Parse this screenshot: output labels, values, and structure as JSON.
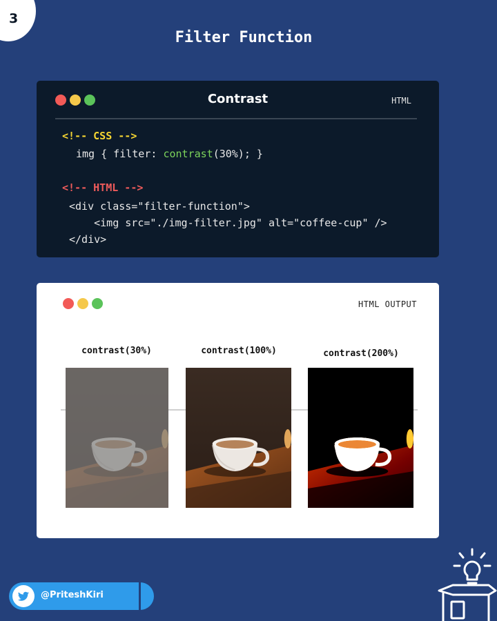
{
  "page_number": "3",
  "slide_title": "Filter Function",
  "code_card": {
    "title": "Contrast",
    "lang": "HTML",
    "css_comment": "<!-- CSS -->",
    "css_line": {
      "selector": "img { filter: ",
      "func": "contrast",
      "args": "(30%); }"
    },
    "html_comment": "<!-- HTML -->",
    "html_lines": [
      "<div class=\"filter-function\">",
      "    <img src=\"./img-filter.jpg\" alt=\"coffee-cup\" />",
      "</div>"
    ]
  },
  "output_card": {
    "tag": "HTML OUTPUT",
    "samples": [
      {
        "label": "contrast(30%)",
        "contrast": 0.3
      },
      {
        "label": "contrast(100%)",
        "contrast": 1.0
      },
      {
        "label": "contrast(200%)",
        "contrast": 2.0
      }
    ]
  },
  "footer": {
    "handle": "@PriteshKiri"
  },
  "colors": {
    "background": "#24407a",
    "code_bg": "#0c1a2a",
    "accent_yellow": "#f6d632",
    "accent_green": "#7cd35b",
    "accent_red": "#ef5b5b",
    "twitter_blue": "#2f9bea"
  }
}
